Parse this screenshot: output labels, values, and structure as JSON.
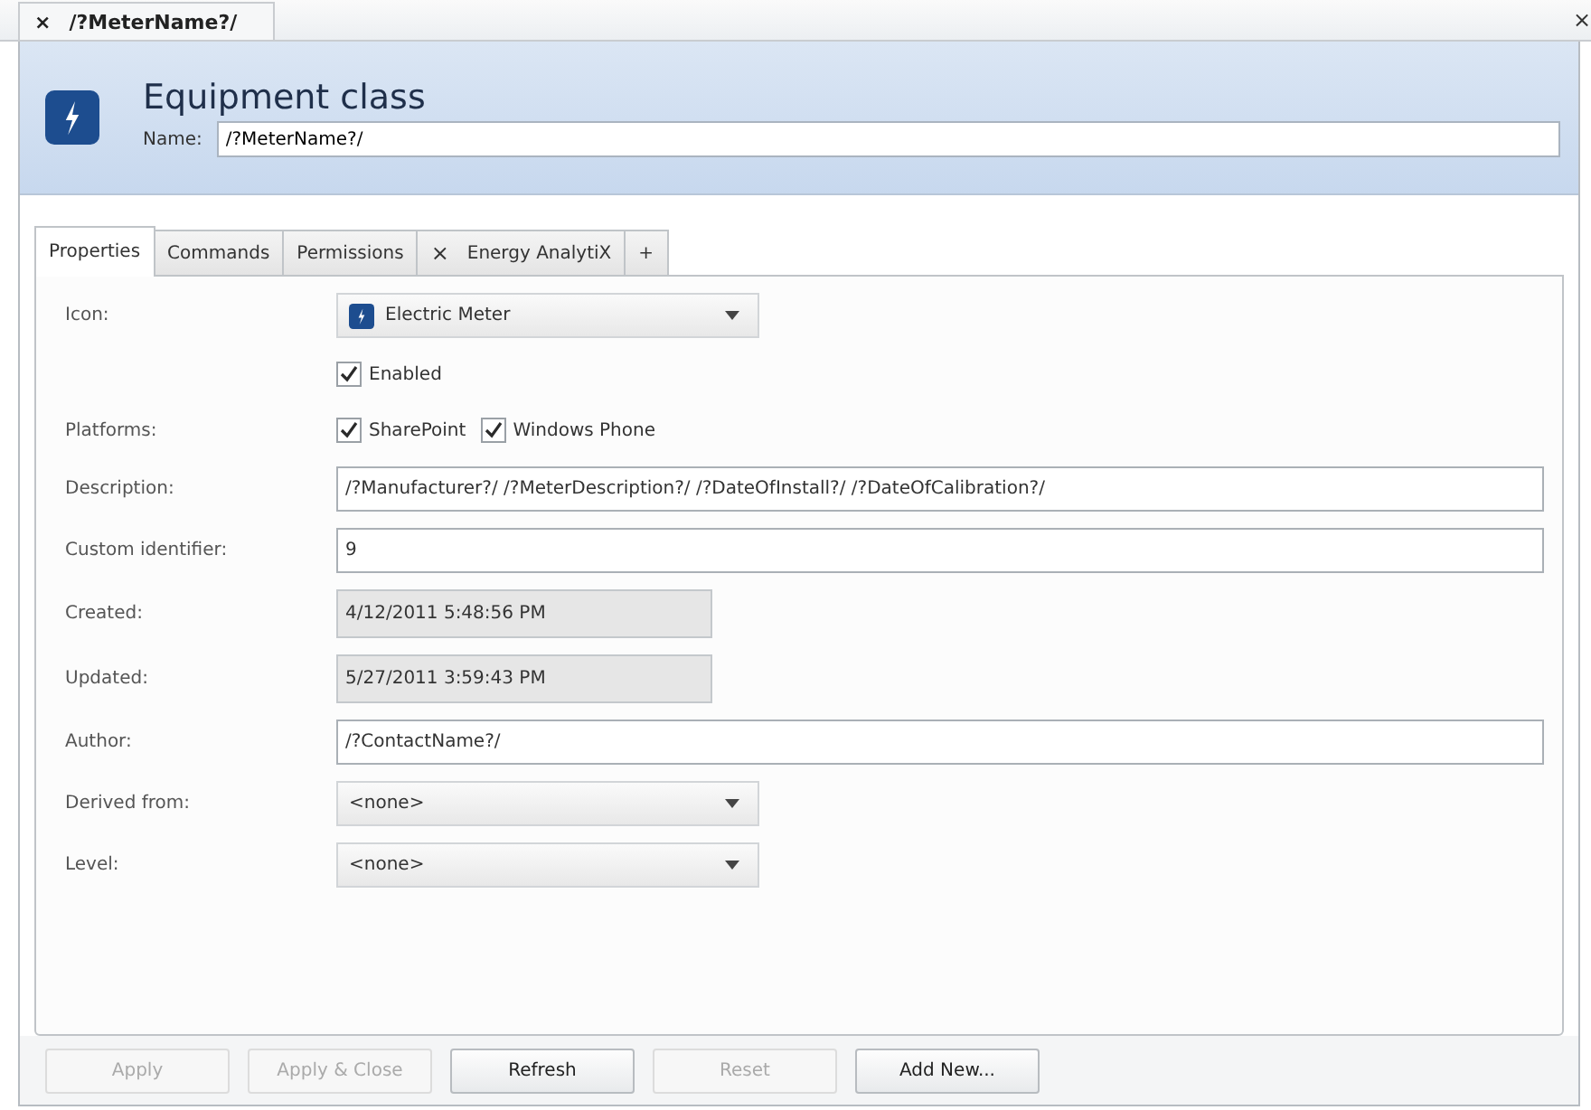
{
  "document_tab": {
    "close": "×",
    "title": "/?MeterName?/"
  },
  "window_close": "×",
  "header": {
    "title": "Equipment class",
    "name_label": "Name:",
    "name_value": "/?MeterName?/"
  },
  "tabs": [
    {
      "label": "Properties",
      "selected": true
    },
    {
      "label": "Commands",
      "selected": false
    },
    {
      "label": "Permissions",
      "selected": false
    },
    {
      "label": "Energy AnalytiX",
      "selected": false,
      "close": "×"
    },
    {
      "label": "+",
      "selected": false
    }
  ],
  "fields": [
    {
      "kind": "dropdown",
      "label": "Icon:",
      "value": "Electric Meter",
      "with_icon": true
    },
    {
      "kind": "checks",
      "checks": [
        {
          "label": "Enabled",
          "checked": true
        }
      ]
    },
    {
      "kind": "checks",
      "label": "Platforms:",
      "checks": [
        {
          "label": "SharePoint",
          "checked": true
        },
        {
          "label": "Windows Phone",
          "checked": true
        }
      ]
    },
    {
      "kind": "text",
      "label": "Description:",
      "value": "/?Manufacturer?/ /?MeterDescription?/ /?DateOfInstall?/ /?DateOfCalibration?/"
    },
    {
      "kind": "text",
      "label": "Custom identifier:",
      "value": "9"
    },
    {
      "kind": "readonly",
      "label": "Created:",
      "value": "4/12/2011 5:48:56 PM"
    },
    {
      "kind": "readonly",
      "label": "Updated:",
      "value": "5/27/2011 3:59:43 PM"
    },
    {
      "kind": "text",
      "label": "Author:",
      "value": "/?ContactName?/"
    },
    {
      "kind": "dropdown",
      "label": "Derived from:",
      "value": "<none>"
    },
    {
      "kind": "dropdown",
      "label": "Level:",
      "value": "<none>"
    }
  ],
  "buttons": [
    {
      "label": "Apply",
      "disabled": true
    },
    {
      "label": "Apply & Close",
      "disabled": true
    },
    {
      "label": "Refresh",
      "disabled": false
    },
    {
      "label": "Reset",
      "disabled": true
    },
    {
      "label": "Add New...",
      "disabled": false
    }
  ]
}
